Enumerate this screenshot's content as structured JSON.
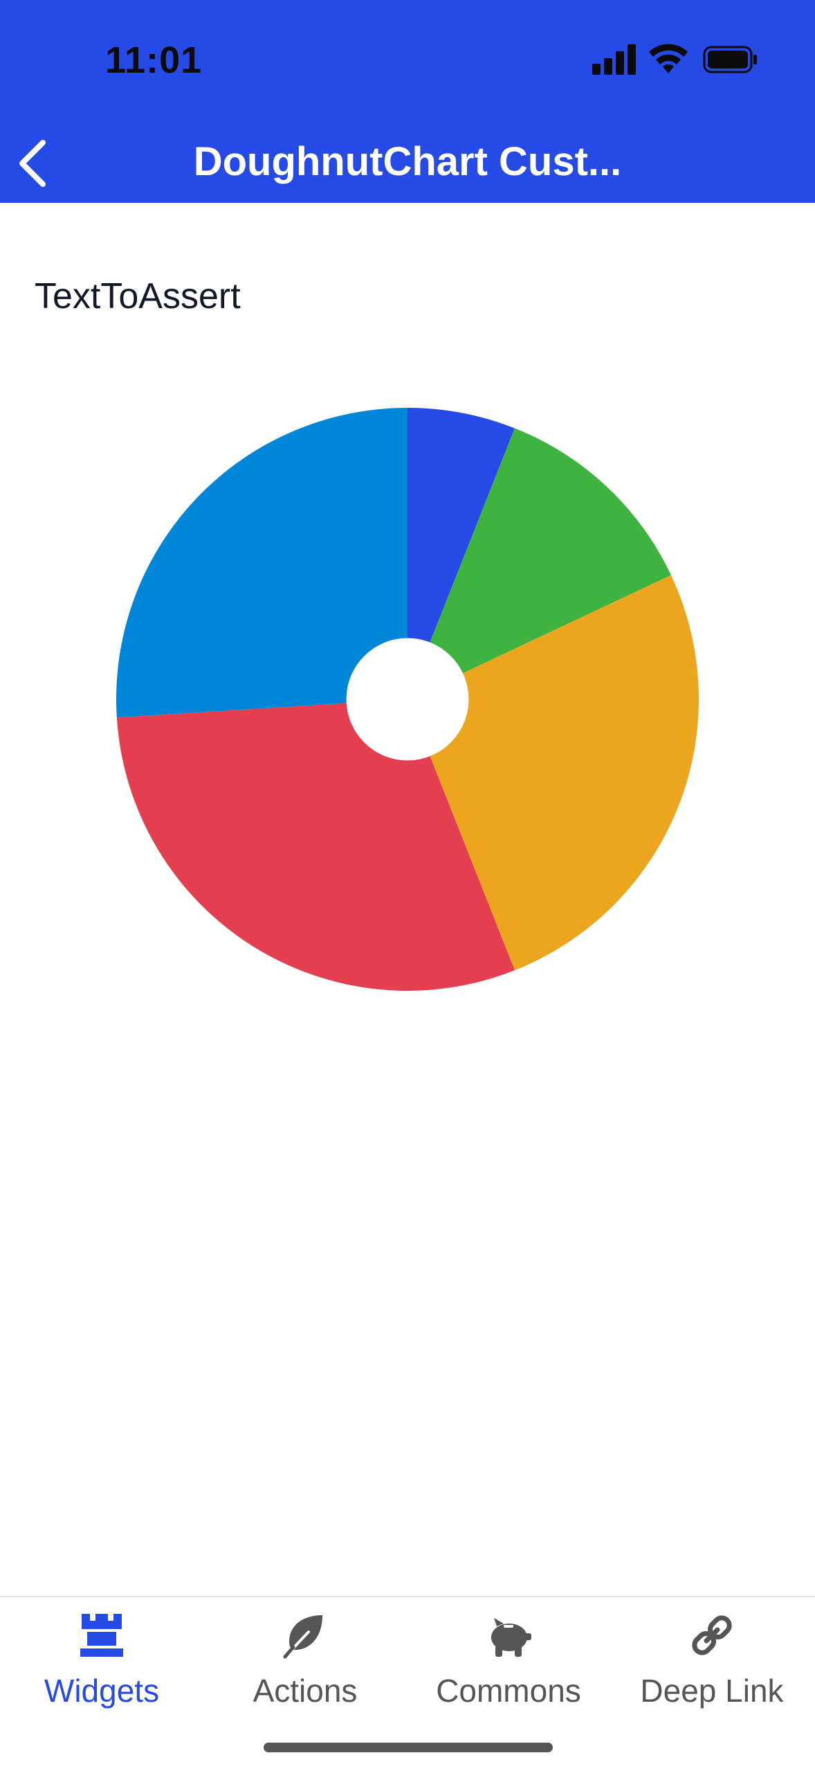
{
  "status_bar": {
    "time": "11:01"
  },
  "header": {
    "title": "DoughnutChart Cust..."
  },
  "content": {
    "text": "TextToAssert"
  },
  "chart_data": {
    "type": "pie",
    "values": [
      6,
      12,
      26,
      30,
      26
    ],
    "colors": [
      "#264AE5",
      "#3EB33F",
      "#EBA51F",
      "#E43F51",
      "#0086D8"
    ],
    "hole_ratio": 0.21
  },
  "tabs": [
    {
      "label": "Widgets",
      "icon": "rook-icon",
      "active": true
    },
    {
      "label": "Actions",
      "icon": "leaf-icon",
      "active": false
    },
    {
      "label": "Commons",
      "icon": "piggy-bank-icon",
      "active": false
    },
    {
      "label": "Deep Link",
      "icon": "link-icon",
      "active": false
    }
  ],
  "colors": {
    "accent": "#264AE5",
    "inactive": "#555555"
  }
}
